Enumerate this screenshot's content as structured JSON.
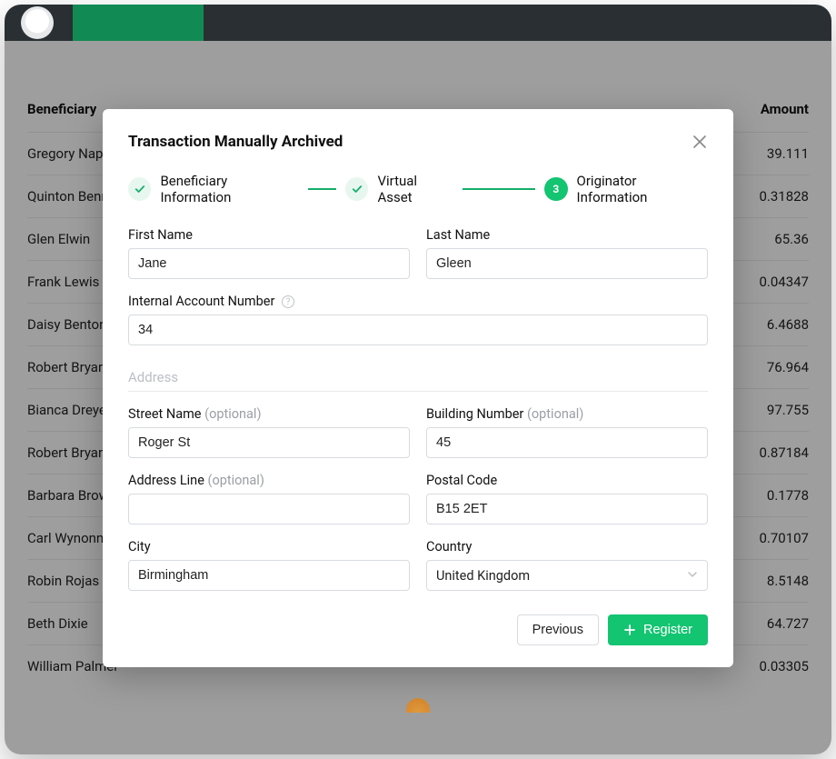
{
  "table": {
    "header": {
      "left": "Beneficiary",
      "right": "Amount"
    },
    "rows": [
      {
        "name": "Gregory Napier",
        "amount": "39.111"
      },
      {
        "name": "Quinton Bennett",
        "amount": "0.31828"
      },
      {
        "name": "Glen Elwin",
        "amount": "65.36"
      },
      {
        "name": "Frank Lewis",
        "amount": "0.04347"
      },
      {
        "name": "Daisy Benton",
        "amount": "6.4688"
      },
      {
        "name": "Robert Bryan",
        "amount": "76.964"
      },
      {
        "name": "Bianca Dreyer",
        "amount": "97.755"
      },
      {
        "name": "Robert Bryan",
        "amount": "0.87184"
      },
      {
        "name": "Barbara Brown",
        "amount": "0.1778"
      },
      {
        "name": "Carl Wynonna",
        "amount": "0.70107"
      },
      {
        "name": "Robin Rojas",
        "amount": "8.5148"
      },
      {
        "name": "Beth Dixie",
        "amount": "64.727"
      },
      {
        "name": "William Palmer",
        "amount": "0.03305"
      }
    ]
  },
  "modal": {
    "title": "Transaction Manually Archived",
    "steps": [
      {
        "label": "Beneficiary Information",
        "state": "done"
      },
      {
        "label": "Virtual Asset",
        "state": "done"
      },
      {
        "label": "Originator Information",
        "state": "current",
        "number": "3"
      }
    ],
    "labels": {
      "first_name": "First Name",
      "last_name": "Last Name",
      "internal_account": "Internal Account Number",
      "address_section": "Address",
      "street": "Street Name",
      "building": "Building Number",
      "addr_line": "Address Line",
      "postal": "Postal Code",
      "city": "City",
      "country": "Country",
      "optional": "(optional)"
    },
    "values": {
      "first_name": "Jane",
      "last_name": "Gleen",
      "internal_account": "34",
      "street": "Roger St",
      "building": "45",
      "addr_line": "",
      "postal": "B15 2ET",
      "city": "Birmingham",
      "country": "United Kingdom"
    },
    "buttons": {
      "previous": "Previous",
      "register": "Register"
    }
  }
}
